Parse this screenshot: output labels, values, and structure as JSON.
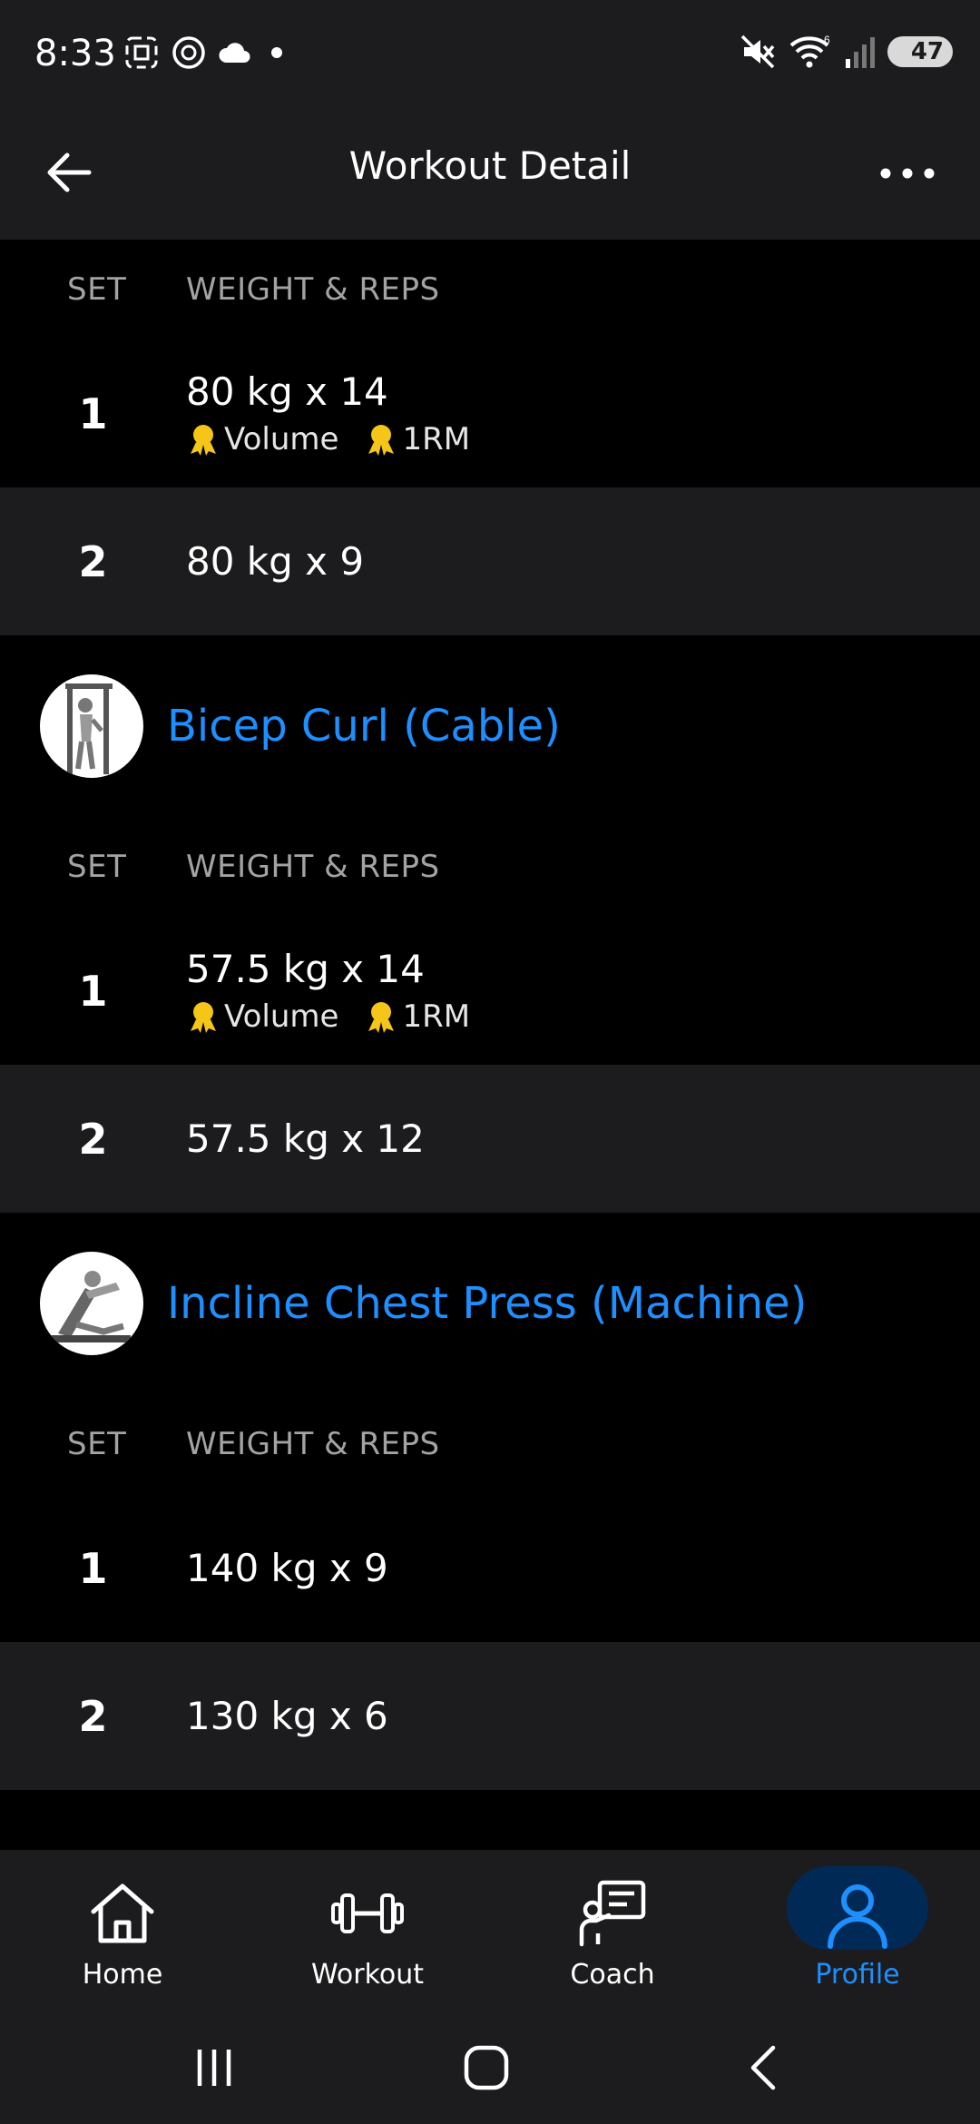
{
  "status": {
    "time": "8:33",
    "battery": "47"
  },
  "header": {
    "title": "Workout Detail"
  },
  "table_headers": {
    "set": "SET",
    "weight_reps": "WEIGHT & REPS"
  },
  "first_block": {
    "sets": [
      {
        "num": "1",
        "value": "80 kg x 14",
        "badges": [
          "Volume",
          "1RM"
        ]
      },
      {
        "num": "2",
        "value": "80 kg x 9",
        "badges": []
      }
    ]
  },
  "exercises": [
    {
      "name": "Bicep Curl (Cable)",
      "sets": [
        {
          "num": "1",
          "value": "57.5 kg x 14",
          "badges": [
            "Volume",
            "1RM"
          ]
        },
        {
          "num": "2",
          "value": "57.5 kg x 12",
          "badges": []
        }
      ]
    },
    {
      "name": "Incline Chest Press (Machine)",
      "sets": [
        {
          "num": "1",
          "value": "140 kg x 9",
          "badges": []
        },
        {
          "num": "2",
          "value": "130 kg x 6",
          "badges": []
        }
      ]
    }
  ],
  "nav": {
    "home": "Home",
    "workout": "Workout",
    "coach": "Coach",
    "profile": "Profile"
  },
  "colors": {
    "accent": "#1e8fff",
    "badge": "#f5c518"
  }
}
